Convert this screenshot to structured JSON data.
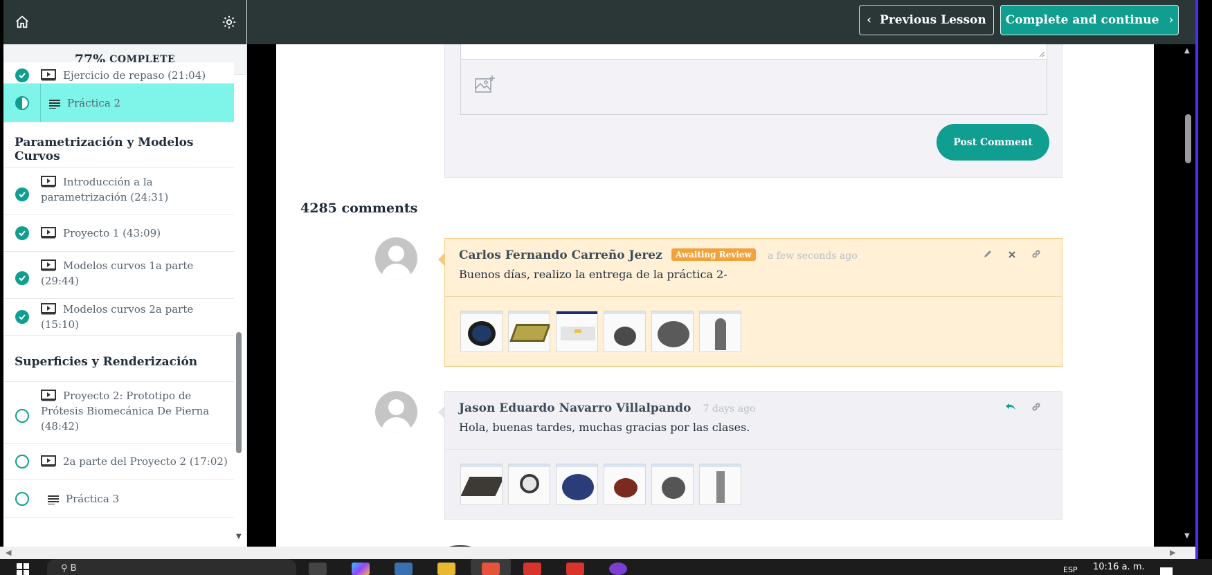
{
  "sidebar": {
    "progress_pct": "77%",
    "progress_word": "COMPLETE",
    "top_lesson": "Ejercicio de repaso (21:04)",
    "active_lesson": "Práctica 2",
    "sections": [
      {
        "title": "Parametrización y Modelos Curvos",
        "lessons": [
          {
            "label": "Introducción a la parametrización (24:31)",
            "status": "complete",
            "type": "video"
          },
          {
            "label": "Proyecto 1 (43:09)",
            "status": "complete",
            "type": "video"
          },
          {
            "label": "Modelos curvos 1a parte (29:44)",
            "status": "complete",
            "type": "video"
          },
          {
            "label": "Modelos curvos 2a parte (15:10)",
            "status": "complete",
            "type": "video"
          }
        ]
      },
      {
        "title": "Superficies y Renderización",
        "lessons": [
          {
            "label": "Proyecto 2: Prototipo de Prótesis Biomecánica De Pierna (48:42)",
            "status": "incomplete",
            "type": "video"
          },
          {
            "label": "2a parte del Proyecto 2 (17:02)",
            "status": "incomplete",
            "type": "video"
          },
          {
            "label": "Práctica 3",
            "status": "incomplete",
            "type": "text"
          }
        ]
      }
    ]
  },
  "header": {
    "prev_label": "Previous Lesson",
    "next_label": "Complete and continue"
  },
  "comment_form": {
    "post_label": "Post Comment"
  },
  "comments_count": "4285 comments",
  "comments": [
    {
      "author": "Carlos Fernando Carreño Jerez",
      "badge": "Awaiting Review",
      "time": "a few seconds ago",
      "text": "Buenos días,  realizo la entrega de la práctica 2-",
      "attachments": 6
    },
    {
      "author": "Jason Eduardo Navarro Villalpando",
      "time": "7 days ago",
      "text": "Hola, buenas tardes, muchas gracias por las clases.",
      "attachments": 6
    }
  ],
  "taskbar": {
    "search_text": "B",
    "lang": "ESP",
    "clock": "10:16 a. m."
  },
  "colors": {
    "accent": "#0f9e90",
    "header_bg": "#2b3637",
    "active_lesson_bg": "#7ff5ea",
    "pending_bg": "#fff0d6",
    "badge": "#f2a23a"
  }
}
